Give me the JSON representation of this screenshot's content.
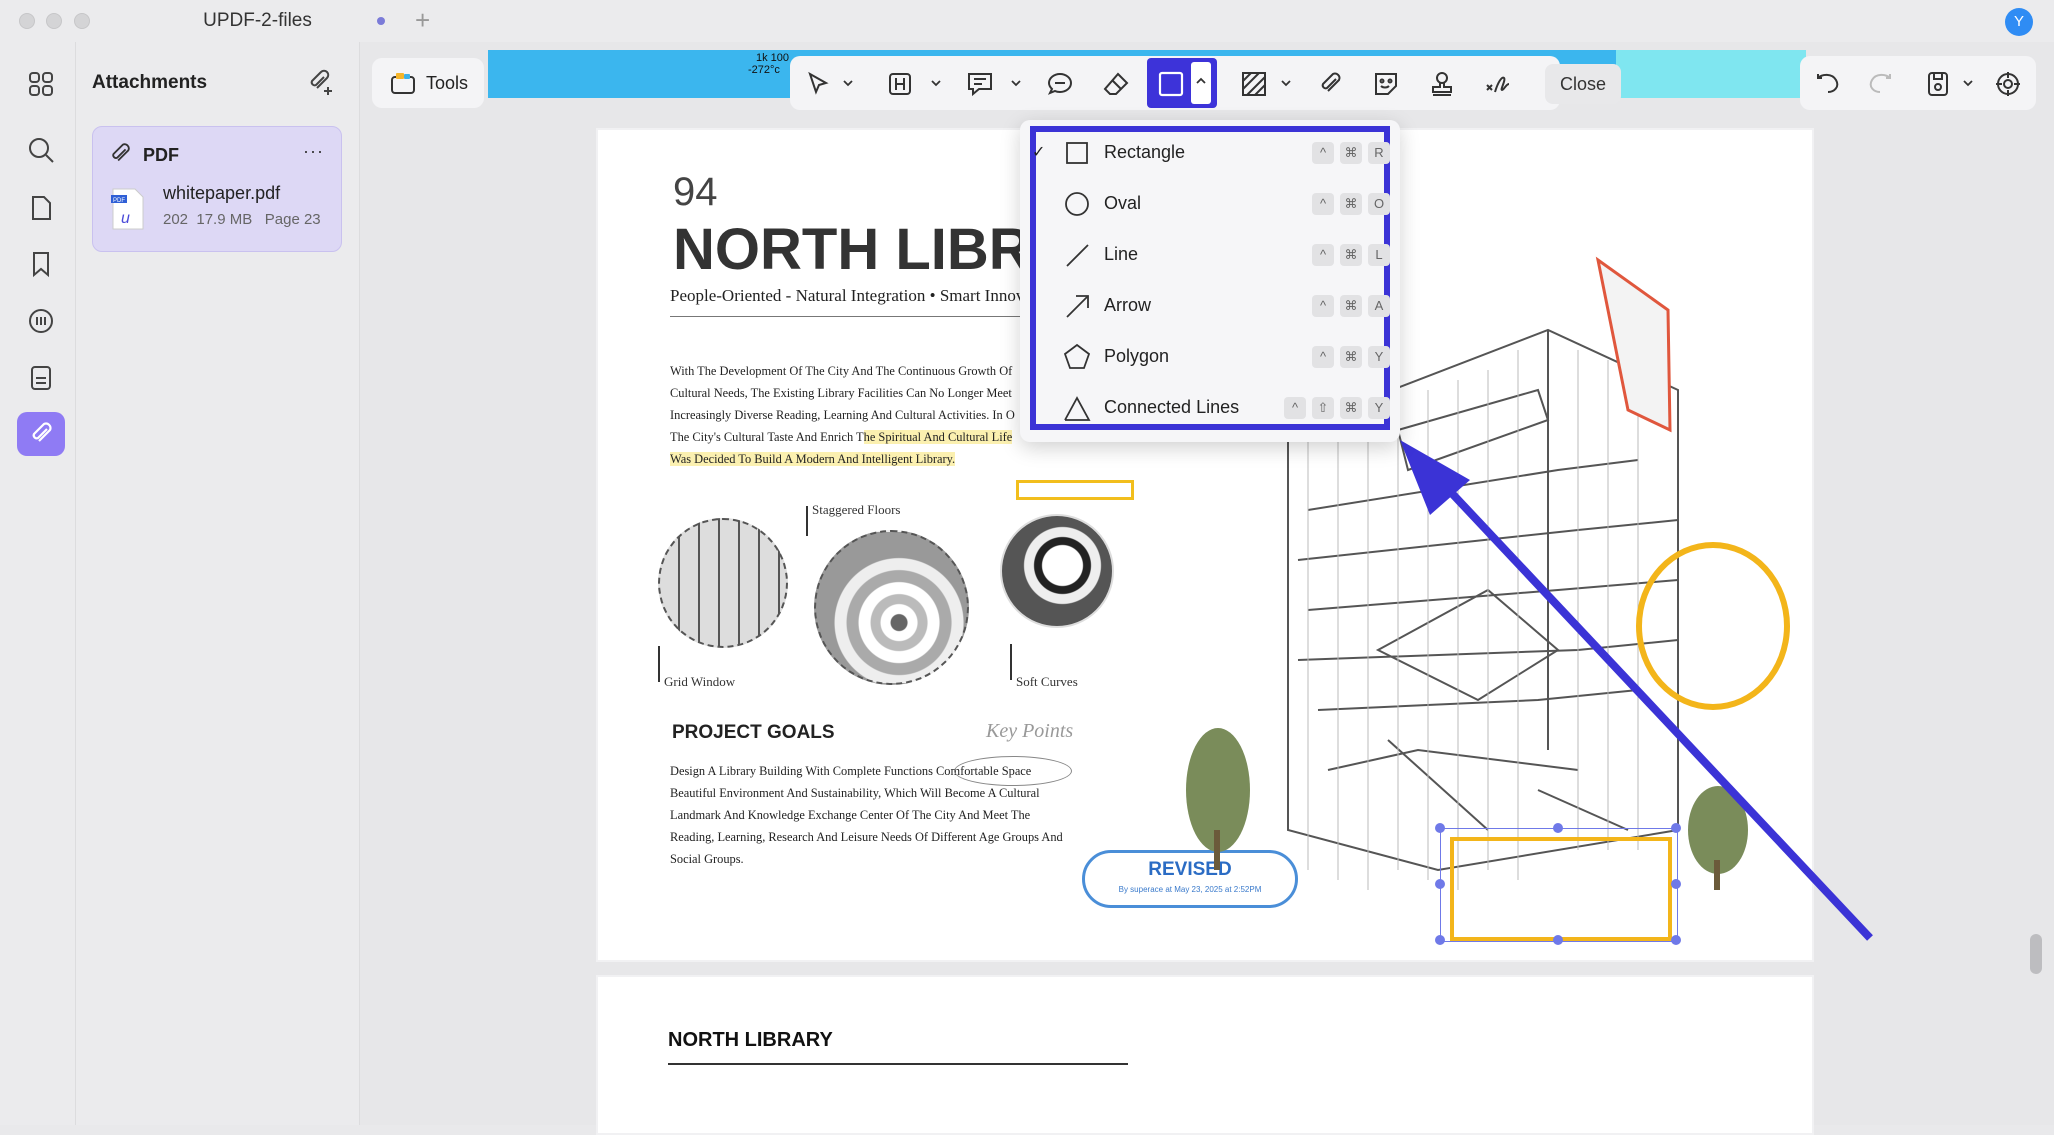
{
  "window": {
    "title": "UPDF-2-files",
    "avatar_initial": "Y",
    "new_tab": "+"
  },
  "rail": {
    "items": [
      "grid-icon",
      "search-icon",
      "page-icon",
      "bookmark-icon",
      "comment-icon",
      "document-icon",
      "attachment-icon"
    ],
    "active": "attachment-icon",
    "accent": "#8f7bf4"
  },
  "panel": {
    "title": "Attachments",
    "card": {
      "label": "PDF",
      "more": "···",
      "file_name": "whitepaper.pdf",
      "file_date": "202",
      "file_size": "17.9 MB",
      "file_page": "Page 23"
    }
  },
  "toolbar": {
    "tools_label": "Tools",
    "close_label": "Close",
    "accent": "#3d33d9",
    "strip_texts": [
      "1k 100",
      "-272°c"
    ]
  },
  "document": {
    "number": "94",
    "title": "NORTH LIBRA",
    "subtitle": "People-Oriented - Natural Integration • Smart Innov",
    "body1_plain": "With The Development Of The City And The Continuous Growth Of Cultural Needs, The Existing Library Facilities Can No Longer Meet Increasingly Diverse Reading, Learning And Cultural Activities. In O The City's Cultural Taste And Enrich T",
    "body1_highlight_a": "he Spiritual And Cultural Life",
    "body1_highlight_b": "Was Decided To Build A Modern And Intelligent Library.",
    "captions": {
      "staggered": "Staggered Floors",
      "grid": "Grid Window",
      "soft": "Soft Curves"
    },
    "goals_title": "PROJECT GOALS",
    "key_points": "Key Points",
    "body2": "Design A Library Building With Complete Functions Comfortable Space Beautiful Environment And Sustainability, Which Will Become A Cultural Landmark And Knowledge Exchange Center Of The City And Meet The Reading, Learning, Research And Leisure Needs Of Different Age Groups And Social Groups.",
    "stamp": {
      "title": "REVISED",
      "subtitle": "By superace at May 23, 2025 at 2:52PM"
    },
    "page2_title": "NORTH LIBRARY"
  },
  "shape_menu": {
    "items": [
      {
        "label": "Rectangle",
        "checked": "✓",
        "keys": [
          "^",
          "⌘",
          "R"
        ]
      },
      {
        "label": "Oval",
        "checked": "",
        "keys": [
          "^",
          "⌘",
          "O"
        ]
      },
      {
        "label": "Line",
        "checked": "",
        "keys": [
          "^",
          "⌘",
          "L"
        ]
      },
      {
        "label": "Arrow",
        "checked": "",
        "keys": [
          "^",
          "⌘",
          "A"
        ]
      },
      {
        "label": "Polygon",
        "checked": "",
        "keys": [
          "^",
          "⌘",
          "Y"
        ]
      },
      {
        "label": "Connected Lines",
        "checked": "",
        "keys": [
          "^",
          "⇧",
          "⌘",
          "Y"
        ]
      }
    ]
  }
}
